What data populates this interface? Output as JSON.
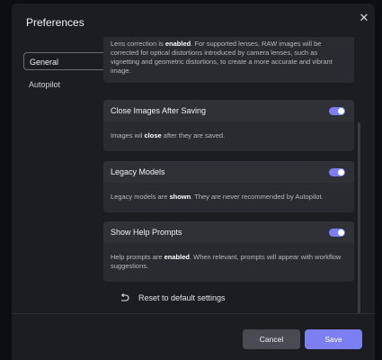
{
  "dialog": {
    "title": "Preferences",
    "close_glyph": "✕"
  },
  "sidebar": {
    "items": [
      {
        "label": "General",
        "active": true
      },
      {
        "label": "Autopilot",
        "active": false
      }
    ]
  },
  "settings": {
    "lens": {
      "body_pre": "Lens correction is ",
      "body_strong": "enabled",
      "body_post": ". For supported lenses, RAW images will be corrected for optical distortions introduced by camera lenses, such as vignetting and geometric distortions, to create a more accurate and vibrant image."
    },
    "close_images": {
      "title": "Close Images After Saving",
      "enabled": true,
      "body_pre": "Images wil ",
      "body_strong": "close",
      "body_post": " after they are saved."
    },
    "legacy_models": {
      "title": "Legacy Models",
      "enabled": true,
      "body_pre": "Legacy models are ",
      "body_strong": "shown",
      "body_post": ". They are never recommended by Autopilot."
    },
    "help_prompts": {
      "title": "Show Help Prompts",
      "enabled": true,
      "body_pre": "Help prompts are ",
      "body_strong": "enabled",
      "body_post": ". When relevant, prompts will appear with workflow suggestions."
    }
  },
  "reset": {
    "label": "Reset to default settings",
    "icon": "undo-icon"
  },
  "footer": {
    "cancel_label": "Cancel",
    "save_label": "Save"
  },
  "colors": {
    "accent": "#7b7ff2",
    "background": "#1c1d21",
    "card": "#2a2b30"
  }
}
